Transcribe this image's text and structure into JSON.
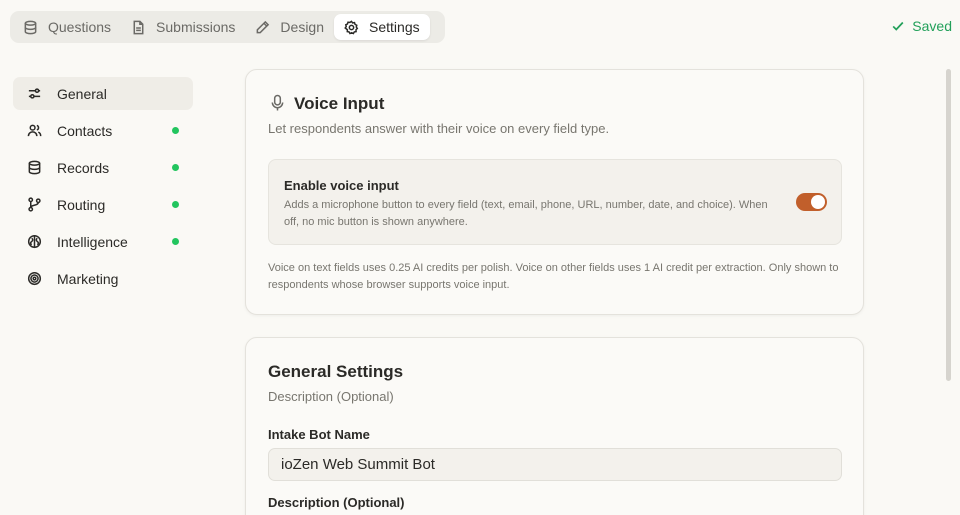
{
  "tabs": [
    {
      "label": "Questions",
      "icon": "database-icon"
    },
    {
      "label": "Submissions",
      "icon": "file-icon"
    },
    {
      "label": "Design",
      "icon": "pen-icon"
    },
    {
      "label": "Settings",
      "icon": "gear-icon",
      "active": true
    }
  ],
  "status": {
    "saved_label": "Saved",
    "color": "#22a05a"
  },
  "sidebar": {
    "items": [
      {
        "label": "General",
        "icon": "sliders-icon",
        "active": true,
        "dot": false
      },
      {
        "label": "Contacts",
        "icon": "users-icon",
        "dot": true
      },
      {
        "label": "Records",
        "icon": "database-icon",
        "dot": true
      },
      {
        "label": "Routing",
        "icon": "git-branch-icon",
        "dot": true
      },
      {
        "label": "Intelligence",
        "icon": "brain-icon",
        "dot": true
      },
      {
        "label": "Marketing",
        "icon": "target-icon",
        "dot": false
      }
    ],
    "dot_color": "#22c55e"
  },
  "voice": {
    "title": "Voice Input",
    "subtitle": "Let respondents answer with their voice on every field type.",
    "toggle_title": "Enable voice input",
    "toggle_desc": "Adds a microphone button to every field (text, email, phone, URL, number, date, and choice). When off, no mic button is shown anywhere.",
    "toggle_on": true,
    "toggle_color": "#c15f2b",
    "footnote": "Voice on text fields uses 0.25 AI credits per polish. Voice on other fields uses 1 AI credit per extraction. Only shown to respondents whose browser supports voice input."
  },
  "general": {
    "title": "General Settings",
    "subtitle": "Description (Optional)",
    "bot_name_label": "Intake Bot Name",
    "bot_name_value": "ioZen Web Summit Bot",
    "description_label": "Description (Optional)"
  }
}
